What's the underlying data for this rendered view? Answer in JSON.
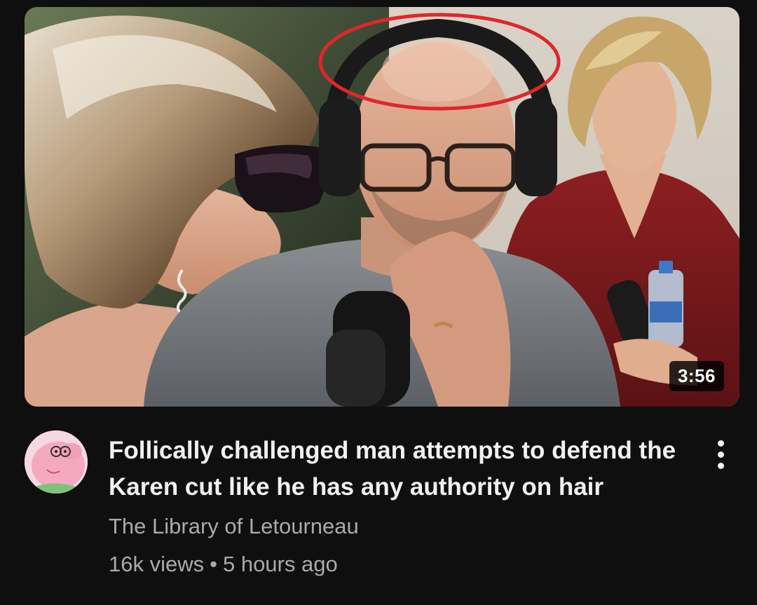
{
  "video": {
    "duration": "3:56",
    "title": "Follically challenged man attempts to defend the Karen cut like he has any authority on hair",
    "channel": "The Library of Letourneau",
    "views": "16k views",
    "separator": "•",
    "age": "5 hours ago"
  },
  "icons": {
    "avatar": "channel-avatar-pink-pig-cartoon",
    "menu": "more-vert-icon"
  },
  "colors": {
    "background": "#0f0f0f",
    "title": "#f1f1f1",
    "secondary_text": "#aaaaaa",
    "annotation_circle": "#e0262b",
    "duration_bg": "#000000"
  }
}
